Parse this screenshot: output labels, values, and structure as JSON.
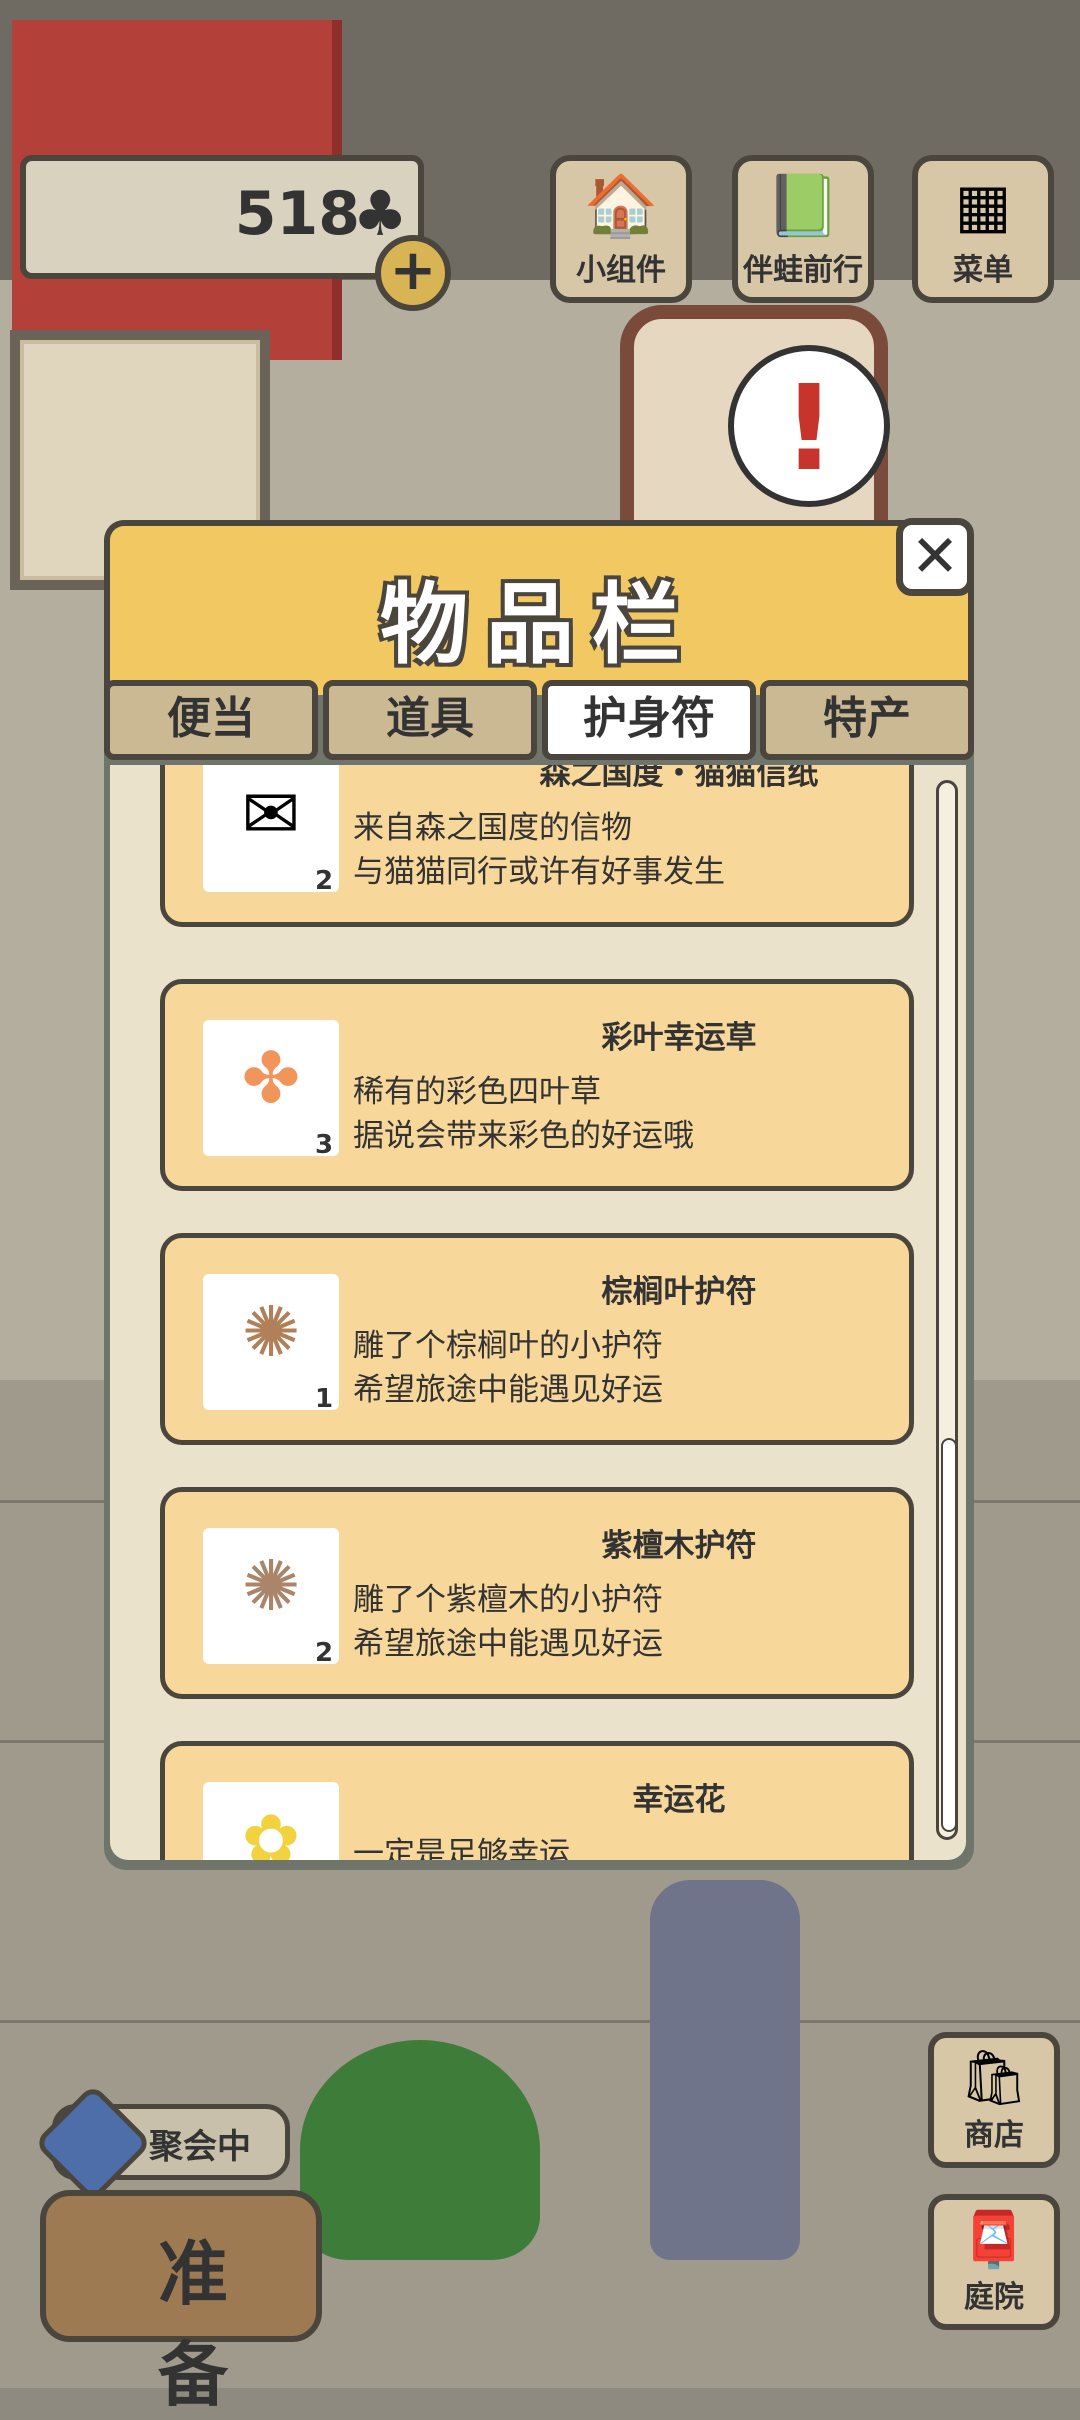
{
  "currency": {
    "value": "518",
    "icon": "clover-icon",
    "add_icon": "+"
  },
  "top_buttons": [
    {
      "label": "小组件",
      "icon": "widget-icon"
    },
    {
      "label": "伴蛙前行",
      "icon": "frog-book-icon"
    },
    {
      "label": "菜单",
      "icon": "menu-icon"
    }
  ],
  "notification": {
    "symbol": "!"
  },
  "modal": {
    "title": "物品栏",
    "close_symbol": "✕",
    "tabs": [
      "便当",
      "道具",
      "护身符",
      "特产"
    ],
    "active_tab": "护身符",
    "items": [
      {
        "name": "森之国度・猫猫信纸",
        "desc1": "来自森之国度的信物",
        "desc2": "与猫猫同行或许有好事发生",
        "qty": "2",
        "icon": "cat-letter-icon",
        "glyph": "✉"
      },
      {
        "name": "彩叶幸运草",
        "desc1": "稀有的彩色四叶草",
        "desc2": "据说会带来彩色的好运哦",
        "qty": "3",
        "icon": "four-leaf-clover-icon",
        "glyph": "✤"
      },
      {
        "name": "棕榈叶护符",
        "desc1": "雕了个棕榈叶的小护符",
        "desc2": "希望旅途中能遇见好运",
        "qty": "1",
        "icon": "palm-charm-icon",
        "glyph": "✺"
      },
      {
        "name": "紫檀木护符",
        "desc1": "雕了个紫檀木的小护符",
        "desc2": "希望旅途中能遇见好运",
        "qty": "2",
        "icon": "rosewood-charm-icon",
        "glyph": "✺"
      },
      {
        "name": "幸运花",
        "desc1": "一定是足够幸运",
        "desc2": "",
        "qty": "",
        "icon": "lucky-flower-icon",
        "glyph": "✿"
      }
    ]
  },
  "side_buttons": [
    {
      "label": "商店",
      "icon": "shop-icon"
    },
    {
      "label": "庭院",
      "icon": "yard-icon"
    }
  ],
  "party": {
    "label": "聚会中"
  },
  "ready_button": {
    "label": "准备"
  },
  "colors": {
    "panel_yellow": "#f2c863",
    "card_bg": "#f8d89a",
    "outline": "#4a463e",
    "list_bg": "#ebe2cc"
  }
}
